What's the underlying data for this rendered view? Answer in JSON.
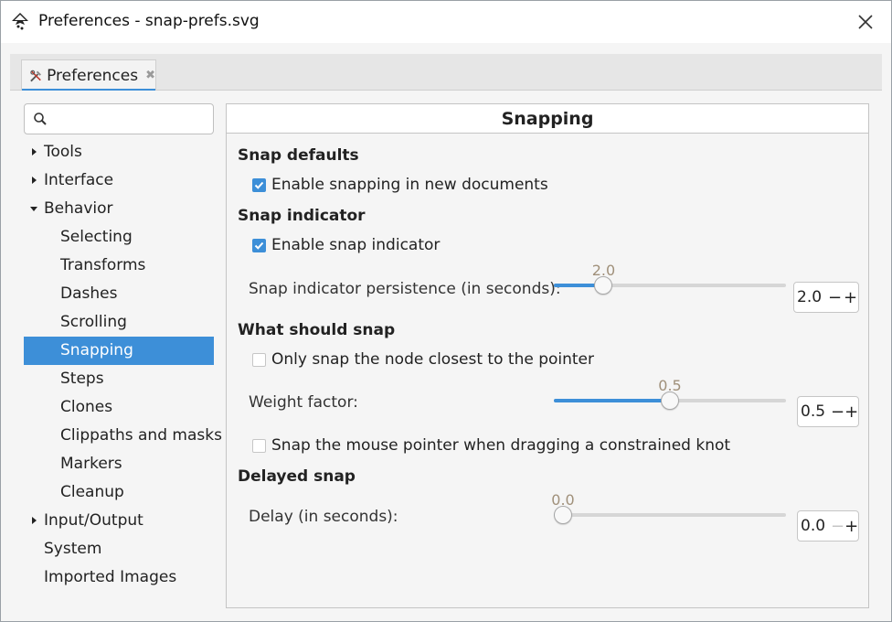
{
  "window": {
    "title": "Preferences - snap-prefs.svg",
    "close_icon": "close-icon"
  },
  "tab": {
    "label": "Preferences",
    "icon": "tools-icon",
    "close_glyph": "✖"
  },
  "search": {
    "placeholder": "",
    "value": ""
  },
  "sidebar": {
    "items": [
      {
        "label": "Tools",
        "level": 1,
        "arrow": "right",
        "selected": false
      },
      {
        "label": "Interface",
        "level": 1,
        "arrow": "right",
        "selected": false
      },
      {
        "label": "Behavior",
        "level": 1,
        "arrow": "down",
        "selected": false
      },
      {
        "label": "Selecting",
        "level": 2,
        "arrow": "",
        "selected": false
      },
      {
        "label": "Transforms",
        "level": 2,
        "arrow": "",
        "selected": false
      },
      {
        "label": "Dashes",
        "level": 2,
        "arrow": "",
        "selected": false
      },
      {
        "label": "Scrolling",
        "level": 2,
        "arrow": "",
        "selected": false
      },
      {
        "label": "Snapping",
        "level": 2,
        "arrow": "",
        "selected": true
      },
      {
        "label": "Steps",
        "level": 2,
        "arrow": "",
        "selected": false
      },
      {
        "label": "Clones",
        "level": 2,
        "arrow": "",
        "selected": false
      },
      {
        "label": "Clippaths and masks",
        "level": 2,
        "arrow": "",
        "selected": false
      },
      {
        "label": "Markers",
        "level": 2,
        "arrow": "",
        "selected": false
      },
      {
        "label": "Cleanup",
        "level": 2,
        "arrow": "",
        "selected": false
      },
      {
        "label": "Input/Output",
        "level": 1,
        "arrow": "right",
        "selected": false
      },
      {
        "label": "System",
        "level": 1,
        "arrow": "",
        "selected": false
      },
      {
        "label": "Imported Images",
        "level": 1,
        "arrow": "",
        "selected": false
      }
    ]
  },
  "panel": {
    "title": "Snapping",
    "snap_defaults": {
      "heading": "Snap defaults",
      "enable_snapping_label": "Enable snapping in new documents",
      "enable_snapping_checked": true
    },
    "snap_indicator": {
      "heading": "Snap indicator",
      "enable_indicator_label": "Enable snap indicator",
      "enable_indicator_checked": true,
      "persistence_label": "Snap indicator persistence (in seconds):",
      "persistence_value_text": "2.0",
      "persistence_value": 2.0,
      "persistence_fraction": 0.19
    },
    "what_should_snap": {
      "heading": "What should snap",
      "only_closest_label": "Only snap the node closest to the pointer",
      "only_closest_checked": false,
      "weight_label": "Weight factor:",
      "weight_value_text": "0.5",
      "weight_value": 0.5,
      "weight_fraction": 0.5,
      "snap_mouse_label": "Snap the mouse pointer when dragging a constrained knot",
      "snap_mouse_checked": false
    },
    "delayed_snap": {
      "heading": "Delayed snap",
      "delay_label": "Delay (in seconds):",
      "delay_value_text": "0.0",
      "delay_value": 0.0,
      "delay_fraction": 0.0
    },
    "spin_minus": "−",
    "spin_plus": "+"
  },
  "colors": {
    "accent": "#3d8fd8",
    "slider_value_text": "#a0907a"
  }
}
